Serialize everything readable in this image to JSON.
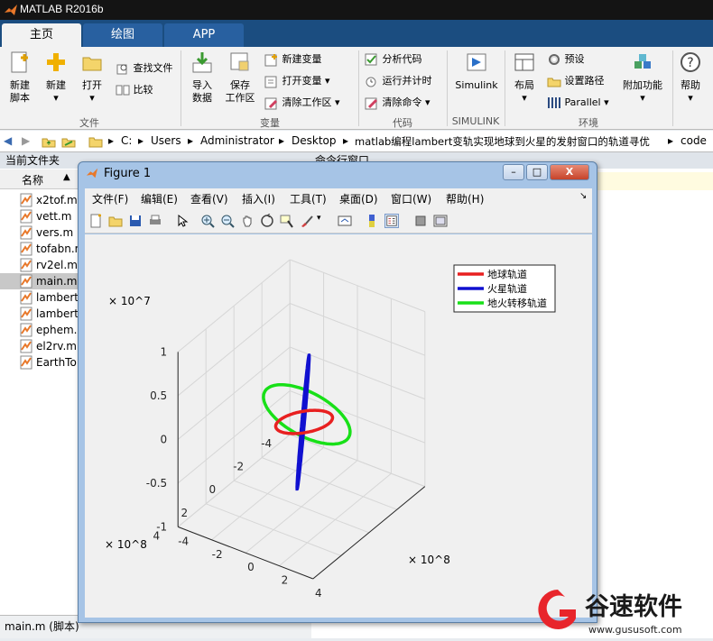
{
  "app": {
    "title": "MATLAB R2016b"
  },
  "tabs": [
    {
      "label": "主页",
      "active": true
    },
    {
      "label": "绘图",
      "active": false
    },
    {
      "label": "APP",
      "active": false
    }
  ],
  "ribbon": {
    "file": {
      "new_script": [
        "新建",
        "脚本"
      ],
      "new": "新建",
      "open": "打开",
      "find_files": "查找文件",
      "compare": "比较",
      "label": "文件"
    },
    "variable": {
      "import": [
        "导入",
        "数据"
      ],
      "save": [
        "保存",
        "工作区"
      ],
      "new_var": "新建变量",
      "open_var": "打开变量",
      "clear_ws": "清除工作区",
      "label": "变量"
    },
    "code": {
      "analyze": "分析代码",
      "run_time": "运行并计时",
      "clear_cmd": "清除命令",
      "label": "代码"
    },
    "simulink": {
      "btn": "Simulink",
      "label": "SIMULINK"
    },
    "env": {
      "layout": "布局",
      "prefs": "预设",
      "set_path": "设置路径",
      "parallel": "Parallel",
      "addons": "附加功能",
      "label": "环境"
    },
    "help": "帮助"
  },
  "address": [
    "C:",
    "Users",
    "Administrator",
    "Desktop",
    "matlab编程lambert变轨实现地球到火星的发射窗口的轨道寻优",
    "code"
  ],
  "left_panel": {
    "header": "当前文件夹",
    "col_name": "名称",
    "sort_arrow": "▲",
    "files": [
      "x2tof.m",
      "vett.m",
      "vers.m",
      "tofabn.m",
      "rv2el.m",
      "main.m",
      "lambert",
      "lambert",
      "ephem.m",
      "el2rv.m",
      "EarthTo"
    ],
    "selected_index": 5,
    "status": "main.m  (脚本)"
  },
  "right_panel": {
    "header": "命令行窗口"
  },
  "figure": {
    "title": "Figure 1",
    "menus": [
      "文件(F)",
      "编辑(E)",
      "查看(V)",
      "插入(I)",
      "工具(T)",
      "桌面(D)",
      "窗口(W)",
      "帮助(H)"
    ],
    "win_buttons": {
      "min": "–",
      "max": "□",
      "close": "X"
    }
  },
  "chart_data": {
    "type": "line",
    "title": "",
    "legend": [
      {
        "name": "地球轨道",
        "color": "#e82020"
      },
      {
        "name": "火星轨道",
        "color": "#1010d0"
      },
      {
        "name": "地火转移轨道",
        "color": "#18e018"
      }
    ],
    "legend_position": "top-right",
    "z_exponent": "× 10^7",
    "x_exponent": "× 10^8",
    "y_exponent": "× 10^8",
    "z_ticks": [
      "1",
      "0.5",
      "0",
      "-0.5",
      "-1"
    ],
    "x_ticks": [
      "4",
      "2",
      "0",
      "-2",
      "-4"
    ],
    "y_ticks": [
      "4",
      "2",
      "0",
      "-2",
      "-4"
    ],
    "zlim": [
      -1,
      1
    ],
    "xlim": [
      -4,
      4
    ],
    "ylim": [
      -4,
      4
    ],
    "grid": true
  },
  "watermark": {
    "text": "谷速软件",
    "url": "www.gususoft.com"
  }
}
